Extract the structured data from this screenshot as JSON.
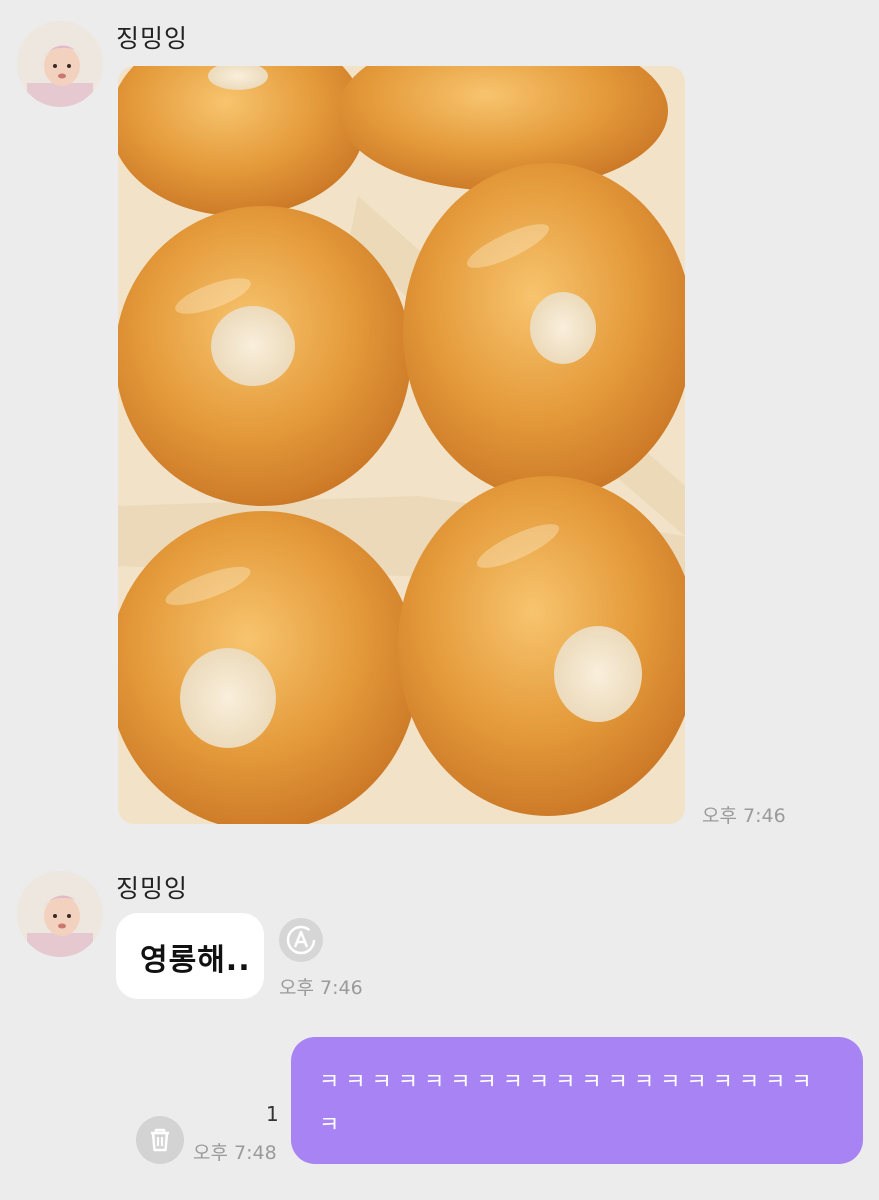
{
  "messages": [
    {
      "sender": "징밍잉",
      "type": "image",
      "image_subject": "glazed-donuts-photo",
      "time": "오후 7:46"
    },
    {
      "sender": "징밍잉",
      "type": "text",
      "text": "영롱해..",
      "time": "오후 7:46"
    },
    {
      "sender": "me",
      "type": "text",
      "text": "ㅋㅋㅋㅋㅋㅋㅋㅋㅋㅋㅋㅋㅋㅋㅋㅋㅋㅋㅋㅋ",
      "time": "오후 7:48",
      "unread_count": "1"
    }
  ],
  "colors": {
    "background": "#ececec",
    "outgoing_bubble": "#a783f4",
    "incoming_bubble": "#ffffff",
    "timestamp": "#9a9a9a"
  },
  "icons": [
    "avatar-baby-photo",
    "translate-icon",
    "trash-icon"
  ]
}
